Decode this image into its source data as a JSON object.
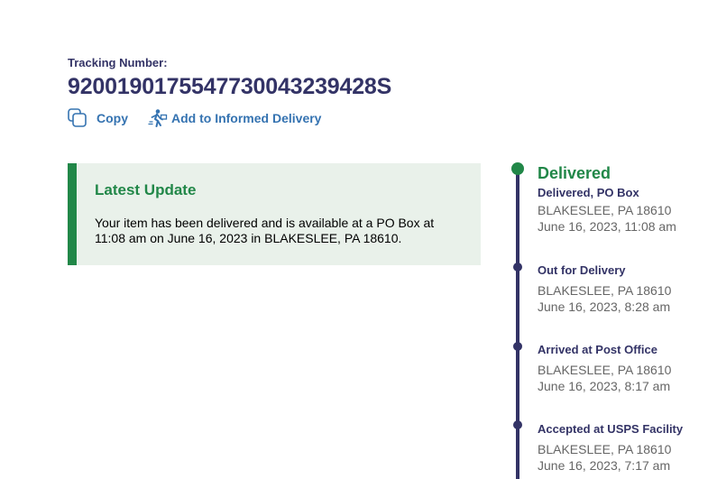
{
  "tracking": {
    "label": "Tracking Number:",
    "number": "9200190175547730043239428S"
  },
  "actions": {
    "copy_label": "Copy",
    "informed_label": "Add to Informed Delivery"
  },
  "latest_update": {
    "title": "Latest Update",
    "body": "Your item has been delivered and is available at a PO Box at 11:08 am on June 16, 2023 in BLAKESLEE, PA 18610."
  },
  "timeline": {
    "current": {
      "headline": "Delivered",
      "status": "Delivered, PO Box",
      "location": "BLAKESLEE, PA 18610",
      "datetime": "June 16, 2023, 11:08 am"
    },
    "events": [
      {
        "status": "Out for Delivery",
        "location": "BLAKESLEE, PA 18610",
        "datetime": "June 16, 2023, 8:28 am"
      },
      {
        "status": "Arrived at Post Office",
        "location": "BLAKESLEE, PA 18610",
        "datetime": "June 16, 2023, 8:17 am"
      },
      {
        "status": "Accepted at USPS Facility",
        "location": "BLAKESLEE, PA 18610",
        "datetime": "June 16, 2023, 7:17 am"
      }
    ]
  },
  "colors": {
    "navy": "#333366",
    "green": "#218748",
    "link": "#3573b1",
    "card_bg": "#e9f1ea",
    "detail_gray": "#666666"
  }
}
